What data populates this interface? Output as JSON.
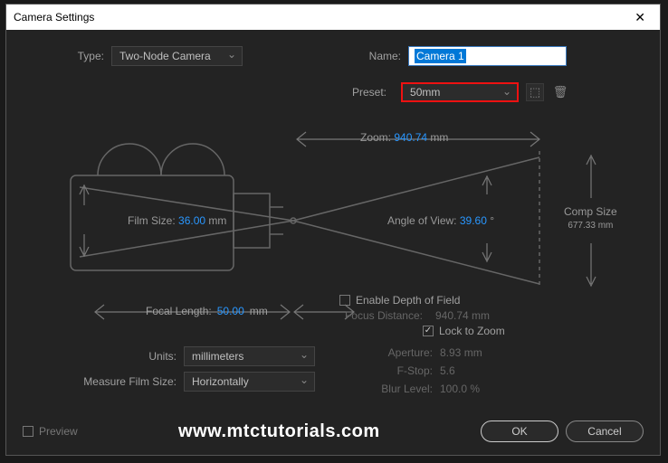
{
  "titlebar": {
    "title": "Camera Settings"
  },
  "form": {
    "type_label": "Type:",
    "type_value": "Two-Node Camera",
    "name_label": "Name:",
    "name_value": "Camera 1",
    "preset_label": "Preset:",
    "preset_value": "50mm"
  },
  "diagram": {
    "zoom_label": "Zoom:",
    "zoom_value": "940.74",
    "zoom_unit": "mm",
    "filmsize_label": "Film Size:",
    "filmsize_value": "36.00",
    "filmsize_unit": "mm",
    "aov_label": "Angle of View:",
    "aov_value": "39.60",
    "aov_unit": "°",
    "compsize_label": "Comp Size",
    "compsize_value": "677.33",
    "compsize_unit": "mm",
    "focal_label": "Focal Length:",
    "focal_value": "50.00",
    "focal_unit": "mm"
  },
  "dof": {
    "enable_label": "Enable Depth of Field",
    "enable_checked": false,
    "focus_label": "Focus Distance:",
    "focus_value": "940.74",
    "focus_unit": "mm",
    "lock_label": "Lock to Zoom",
    "lock_checked": true,
    "aperture_label": "Aperture:",
    "aperture_value": "8.93",
    "aperture_unit": "mm",
    "fstop_label": "F-Stop:",
    "fstop_value": "5.6",
    "blur_label": "Blur Level:",
    "blur_value": "100.0",
    "blur_unit": "%"
  },
  "units": {
    "units_label": "Units:",
    "units_value": "millimeters",
    "measure_label": "Measure Film Size:",
    "measure_value": "Horizontally"
  },
  "footer": {
    "preview_label": "Preview",
    "watermark": "www.mtctutorials.com",
    "ok": "OK",
    "cancel": "Cancel"
  }
}
